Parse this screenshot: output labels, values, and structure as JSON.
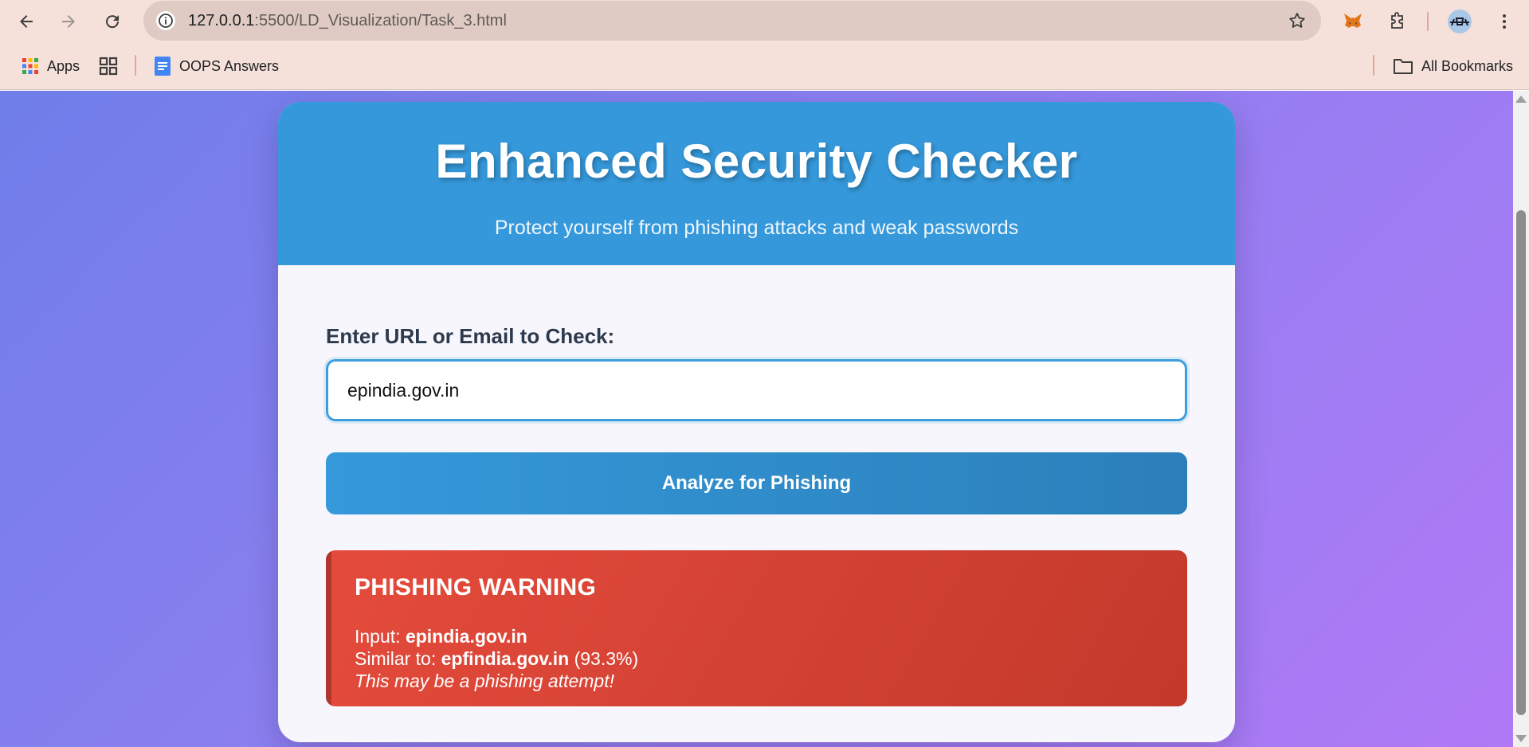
{
  "browser": {
    "url_host": "127.0.0.1",
    "url_rest": ":5500/LD_Visualization/Task_3.html",
    "bookmarks": [
      {
        "label": "Apps"
      },
      {
        "label": "OOPS Answers"
      }
    ],
    "all_bookmarks_label": "All Bookmarks"
  },
  "page": {
    "title": "Enhanced Security Checker",
    "subtitle": "Protect yourself from phishing attacks and weak passwords",
    "input_label": "Enter URL or Email to Check:",
    "input_value": "epindia.gov.in",
    "analyze_button": "Analyze for Phishing",
    "result": {
      "heading": "PHISHING WARNING",
      "input_prefix": "Input: ",
      "input_value": "epindia.gov.in",
      "similar_prefix": "Similar to: ",
      "similar_value": "epfindia.gov.in",
      "similarity": "(93.3%)",
      "message": "This may be a phishing attempt!"
    }
  },
  "colors": {
    "header": "#3598da",
    "warning": "#e54b3c",
    "bg_start": "#6f7eea",
    "bg_end": "#b079f6"
  }
}
